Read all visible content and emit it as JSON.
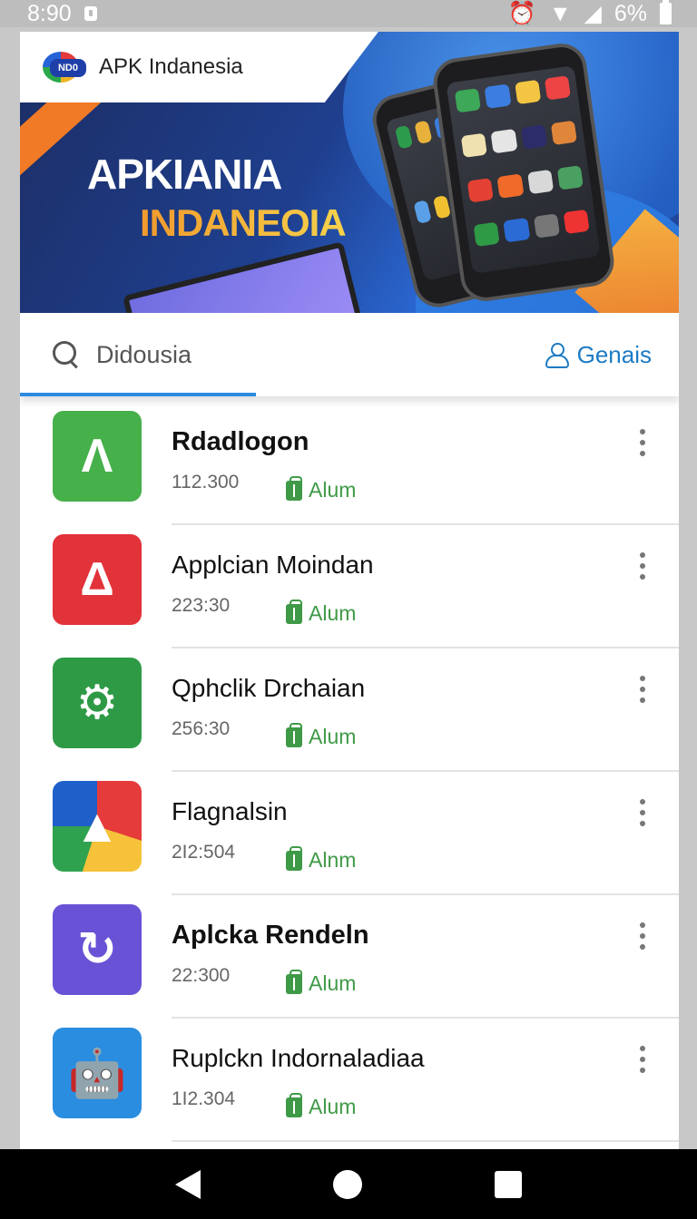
{
  "status_bar": {
    "time": "8:90",
    "battery": "6%"
  },
  "header": {
    "logo_text": "APK Indanesia",
    "logo_badge": "ND0"
  },
  "banner": {
    "title_line1": "APKIANIA",
    "title_line2": "INDANEOIA"
  },
  "search": {
    "placeholder": "Didousia",
    "genre_label": "Genais"
  },
  "apps": [
    {
      "title": "Rdadlogon",
      "size": "112.300",
      "tag": "Alum",
      "icon": "android-a-icon",
      "color": "#46b04a"
    },
    {
      "title": "Applcian Moindan",
      "size": "223:30",
      "tag": "Alum",
      "icon": "red-arrow-icon",
      "color": "#e2323a"
    },
    {
      "title": "Qphclik Drchaian",
      "size": "256:30",
      "tag": "Alum",
      "icon": "gear-icon",
      "color": "#2f9a46"
    },
    {
      "title": "Flagnalsin",
      "size": "2I2:504",
      "tag": "Alnm",
      "icon": "triangle-logo-icon",
      "color": "#1f7fc1"
    },
    {
      "title": "Aplcka Rendeln",
      "size": "22:300",
      "tag": "Alum",
      "icon": "refresh-ring-icon",
      "color": "#6a52d6"
    },
    {
      "title": "Ruplckn Indornaladiaa",
      "size": "1I2.304",
      "tag": "Alum",
      "icon": "android-robot-icon",
      "color": "#2a8de0"
    }
  ]
}
